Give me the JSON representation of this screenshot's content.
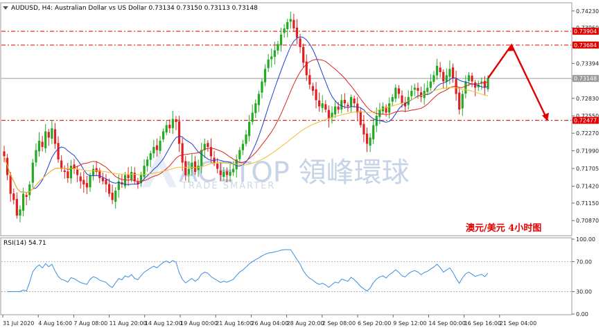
{
  "header": {
    "symbol_line": "AUDUSD, H4:  Australian Dollar vs US Dollar  0.73134 0.73150 0.73113 0.73148",
    "caption": "澳元/美元  4小时图"
  },
  "watermark": {
    "brand": "ACETOP 領峰環球",
    "tagline": "TRADE SMARTER"
  },
  "chart_data": [
    {
      "type": "candlestick",
      "title": "AUDUSD, H4",
      "ylim": [
        0.7065,
        0.7435
      ],
      "price_ticks": [
        "0.74230",
        "0.73960",
        "0.73684",
        "0.73394",
        "0.73148",
        "0.72830",
        "0.72550",
        "0.72477",
        "0.72270",
        "0.71990",
        "0.71705",
        "0.71420",
        "0.71150",
        "0.70870"
      ],
      "tick_values": [
        0.7423,
        0.7396,
        0.7368,
        0.7339,
        0.7314,
        0.7283,
        0.7255,
        0.7248,
        0.7227,
        0.7199,
        0.71705,
        0.7142,
        0.7115,
        0.7087
      ],
      "tagged_levels": [
        {
          "label": "0.73904",
          "value": 0.73904,
          "color": "#e00000"
        },
        {
          "label": "0.73684",
          "value": 0.73684,
          "color": "#e00000"
        },
        {
          "label": "0.72477",
          "value": 0.72477,
          "color": "#e00000"
        },
        {
          "label": "0.73148",
          "value": 0.73148,
          "color": "#9a9a9a"
        }
      ],
      "close_series": [
        0.719,
        0.716,
        0.713,
        0.712,
        0.7095,
        0.7105,
        0.713,
        0.7125,
        0.7145,
        0.718,
        0.72,
        0.7215,
        0.7205,
        0.723,
        0.722,
        0.7235,
        0.721,
        0.7185,
        0.717,
        0.7165,
        0.7155,
        0.7175,
        0.717,
        0.716,
        0.715,
        0.7145,
        0.714,
        0.716,
        0.717,
        0.7165,
        0.7155,
        0.715,
        0.7145,
        0.713,
        0.712,
        0.7135,
        0.715,
        0.7145,
        0.716,
        0.7155,
        0.7165,
        0.715,
        0.7145,
        0.716,
        0.7175,
        0.7185,
        0.7195,
        0.7205,
        0.72,
        0.7215,
        0.723,
        0.724,
        0.7235,
        0.725,
        0.7245,
        0.721,
        0.718,
        0.716,
        0.717,
        0.718,
        0.7165,
        0.7175,
        0.72,
        0.721,
        0.7205,
        0.719,
        0.718,
        0.717,
        0.716,
        0.7165,
        0.716,
        0.7165,
        0.717,
        0.7185,
        0.72,
        0.721,
        0.7225,
        0.7245,
        0.726,
        0.7275,
        0.729,
        0.731,
        0.733,
        0.7345,
        0.735,
        0.736,
        0.737,
        0.7385,
        0.7395,
        0.7405,
        0.741,
        0.7395,
        0.738,
        0.7365,
        0.734,
        0.732,
        0.7305,
        0.7295,
        0.728,
        0.727,
        0.7275,
        0.7265,
        0.725,
        0.726,
        0.727,
        0.7265,
        0.728,
        0.7275,
        0.727,
        0.7285,
        0.7275,
        0.726,
        0.724,
        0.7225,
        0.721,
        0.722,
        0.724,
        0.7255,
        0.7265,
        0.727,
        0.726,
        0.7275,
        0.7285,
        0.73,
        0.729,
        0.7275,
        0.727,
        0.7285,
        0.7295,
        0.73,
        0.7295,
        0.7285,
        0.7295,
        0.73,
        0.731,
        0.732,
        0.7335,
        0.7325,
        0.731,
        0.732,
        0.733,
        0.7315,
        0.729,
        0.7265,
        0.729,
        0.731,
        0.732,
        0.731,
        0.73,
        0.7305,
        0.731,
        0.73,
        0.7315
      ],
      "forecast_arrow": {
        "start": 0.7315,
        "peak": 0.73684,
        "end": 0.72477
      }
    },
    {
      "type": "line",
      "title": "RSI(14) 54.71",
      "ylim": [
        0,
        100
      ],
      "tick_labels": [
        "100.00",
        "70.00",
        "30.00",
        "0.00"
      ],
      "tick_values": [
        100,
        70,
        30,
        0
      ],
      "levels": [
        70,
        30
      ],
      "current": 54.71
    }
  ],
  "x_axis": {
    "labels": [
      "31 Jul 2020",
      "4 Aug 16:00",
      "7 Aug 08:00",
      "11 Aug 20:00",
      "14 Aug 12:00",
      "19 Aug 00:00",
      "21 Aug 16:00",
      "26 Aug 04:00",
      "28 Aug 20:00",
      "2 Sep 08:00",
      "6 Sep 20:00",
      "9 Sep 12:00",
      "14 Sep 00:00",
      "16 Sep 16:00",
      "21 Sep 04:00"
    ]
  },
  "colors": {
    "bull": "#22aa22",
    "bear": "#e02020",
    "ma_fast": "#1a3fd0",
    "ma_mid": "#e02020",
    "ma_slow": "#f0c020",
    "rsi": "#3b8ede",
    "resistance": "#e00000",
    "arrow": "#e00000"
  }
}
